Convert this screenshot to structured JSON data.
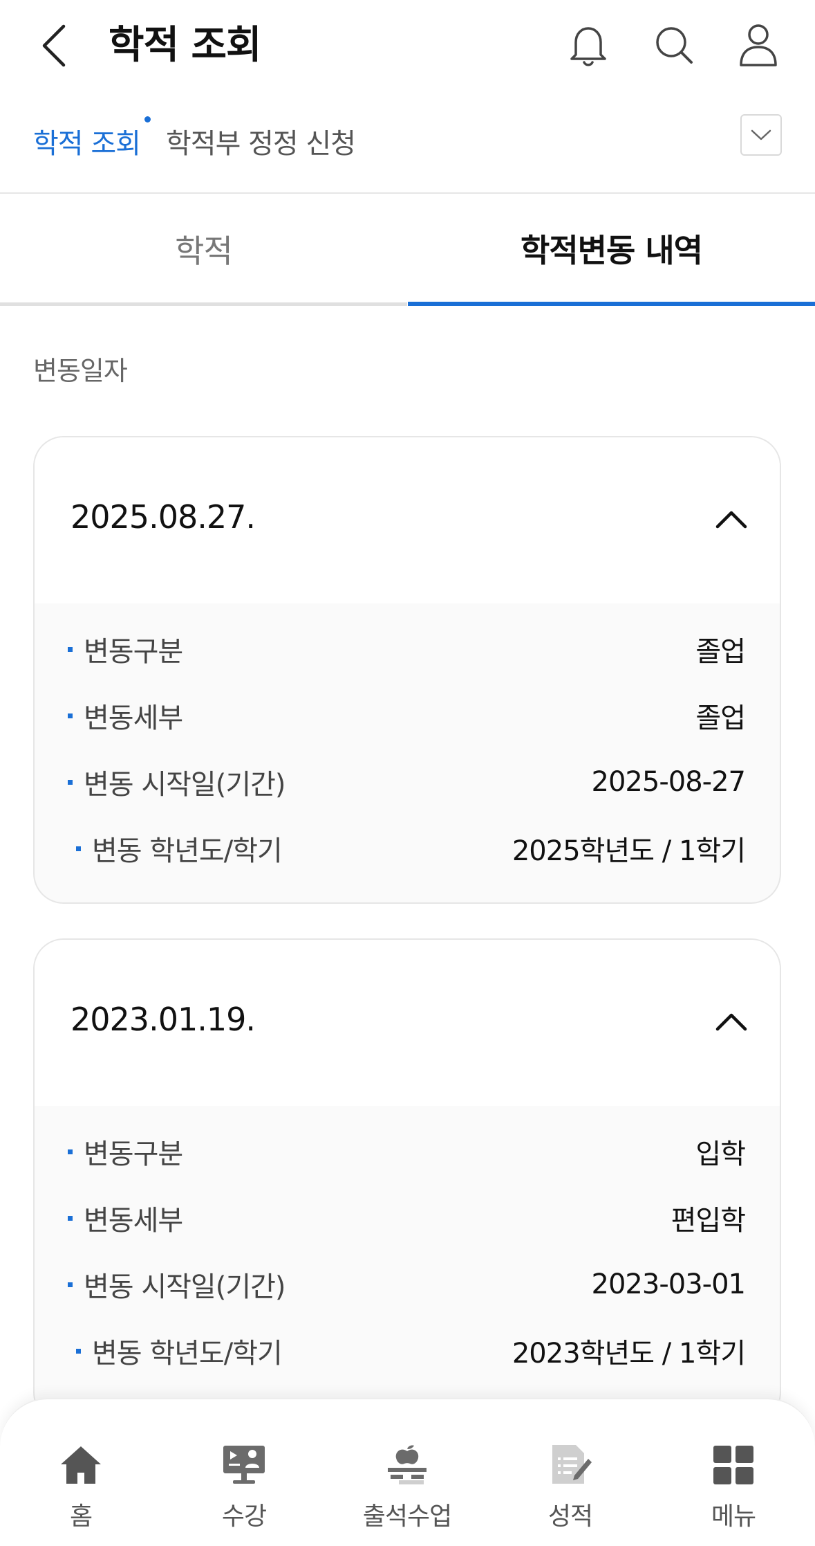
{
  "header": {
    "title": "학적 조회"
  },
  "subnav": {
    "items": [
      {
        "label": "학적 조회"
      },
      {
        "label": "학적부 정정 신청"
      }
    ]
  },
  "tabs": [
    {
      "label": "학적"
    },
    {
      "label": "학적변동 내역"
    }
  ],
  "section_label": "변동일자",
  "records": [
    {
      "date": "2025.08.27.",
      "rows": [
        {
          "label": "변동구분",
          "value": "졸업"
        },
        {
          "label": "변동세부",
          "value": "졸업"
        },
        {
          "label": "변동 시작일(기간)",
          "value": "2025-08-27"
        },
        {
          "label": "변동 학년도/학기",
          "value": "2025학년도 / 1학기"
        }
      ]
    },
    {
      "date": "2023.01.19.",
      "rows": [
        {
          "label": "변동구분",
          "value": "입학"
        },
        {
          "label": "변동세부",
          "value": "편입학"
        },
        {
          "label": "변동 시작일(기간)",
          "value": "2023-03-01"
        },
        {
          "label": "변동 학년도/학기",
          "value": "2023학년도 / 1학기"
        }
      ]
    }
  ],
  "bottom_nav": [
    {
      "label": "홈",
      "icon": "home-icon"
    },
    {
      "label": "수강",
      "icon": "lecture-icon"
    },
    {
      "label": "출석수업",
      "icon": "attendance-class-icon"
    },
    {
      "label": "성적",
      "icon": "grades-icon"
    },
    {
      "label": "메뉴",
      "icon": "menu-grid-icon"
    }
  ],
  "colors": {
    "accent": "#1a6fd6",
    "icon_gray": "#555555"
  }
}
